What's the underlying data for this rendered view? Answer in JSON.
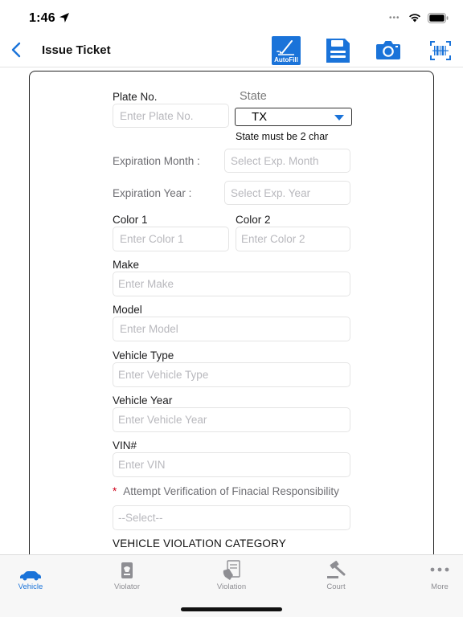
{
  "status": {
    "time": "1:46"
  },
  "nav": {
    "title": "Issue Ticket",
    "autofill_label": "AutoFill"
  },
  "form": {
    "plate": {
      "label": "Plate No.",
      "placeholder": "Enter Plate No.",
      "value": ""
    },
    "state": {
      "label": "State",
      "value": "TX",
      "hint": "State must be 2 char"
    },
    "exp_month": {
      "label": "Expiration Month :",
      "placeholder": "Select Exp. Month"
    },
    "exp_year": {
      "label": "Expiration Year :",
      "placeholder": "Select Exp. Year"
    },
    "color1": {
      "label": "Color 1",
      "placeholder": "Enter Color 1"
    },
    "color2": {
      "label": "Color 2",
      "placeholder": "Enter Color 2"
    },
    "make": {
      "label": "Make",
      "placeholder": "Enter Make"
    },
    "model": {
      "label": "Model",
      "placeholder": "Enter Model"
    },
    "vehicle_type": {
      "label": "Vehicle Type",
      "placeholder": "Enter Vehicle Type"
    },
    "vehicle_year": {
      "label": "Vehicle Year",
      "placeholder": "Enter Vehicle Year"
    },
    "vin": {
      "label": "VIN#",
      "placeholder": "Enter VIN"
    },
    "financial": {
      "required_mark": "*",
      "label": "Attempt Verification of Finacial Responsibility",
      "placeholder": "--Select--"
    },
    "section_title": "VEHICLE VIOLATION CATEGORY"
  },
  "tabs": [
    {
      "label": "Vehicle",
      "icon": "car-icon",
      "active": true
    },
    {
      "label": "Violator",
      "icon": "violator-icon",
      "active": false
    },
    {
      "label": "Violation",
      "icon": "violation-icon",
      "active": false
    },
    {
      "label": "Court",
      "icon": "gavel-icon",
      "active": false
    },
    {
      "label": "More",
      "icon": "more-icon",
      "active": false
    }
  ],
  "colors": {
    "accent": "#1a73d9",
    "required": "#d0021b",
    "placeholder": "#b8b8bd"
  }
}
